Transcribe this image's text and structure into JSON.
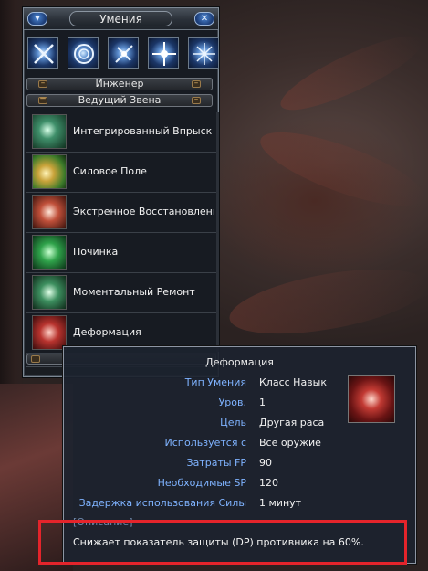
{
  "window": {
    "title": "Умения",
    "close_glyph": "✕",
    "menu_glyph": "▾"
  },
  "tabs": [
    {
      "name": "sword-icon"
    },
    {
      "name": "target-icon"
    },
    {
      "name": "sparkle-icon"
    },
    {
      "name": "star-burst-icon"
    },
    {
      "name": "cross-star-icon"
    }
  ],
  "categories": {
    "class": "Инженер",
    "subclass": "Ведущий Звена"
  },
  "skills": [
    {
      "name": "Интегрированный Впрыск",
      "icon": "injection-skill-icon",
      "color": "#3f8f6a"
    },
    {
      "name": "Силовое Поле",
      "icon": "force-field-skill-icon",
      "color": "#c9a33a"
    },
    {
      "name": "Экстренное Восстановление",
      "icon": "emergency-restore-skill-icon",
      "color": "#c0503a"
    },
    {
      "name": "Починка",
      "icon": "repair-skill-icon",
      "color": "#2fa24a"
    },
    {
      "name": "Моментальный Ремонт",
      "icon": "instant-repair-skill-icon",
      "color": "#3d8f5f"
    },
    {
      "name": "Деформация",
      "icon": "deformation-skill-icon",
      "color": "#b8332e"
    }
  ],
  "tooltip": {
    "title": "Деформация",
    "rows": [
      {
        "label": "Тип Умения",
        "value": "Класс Навык"
      },
      {
        "label": "Уров.",
        "value": "1"
      },
      {
        "label": "Цель",
        "value": "Другая раса"
      },
      {
        "label": "Используется с",
        "value": "Все оружие"
      },
      {
        "label": "Затраты FP",
        "value": "90"
      },
      {
        "label": "Необходимые SP",
        "value": "120"
      },
      {
        "label": "Задержка использования Силы",
        "value": "1 минут"
      }
    ],
    "desc_header": "[Описание]",
    "desc_text": "Снижает показатель защиты (DP) противника на 60%."
  },
  "colors": {
    "label_blue": "#7fb3ff",
    "highlight_red": "#e4242b"
  }
}
